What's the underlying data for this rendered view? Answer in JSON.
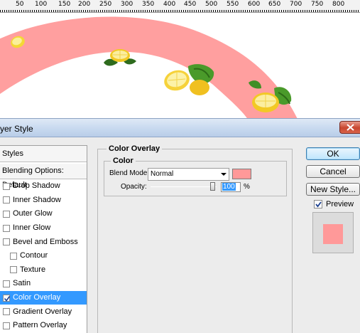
{
  "ruler": {
    "labels": [
      "50",
      "100",
      "150",
      "200",
      "250",
      "300",
      "350",
      "400",
      "450",
      "500",
      "550",
      "600",
      "650",
      "700",
      "750",
      "800"
    ]
  },
  "dialog": {
    "title": "yer Style",
    "styles_header": "Styles",
    "blending_options": "Blending Options: Default",
    "items": [
      {
        "label": "Drop Shadow",
        "checked": false
      },
      {
        "label": "Inner Shadow",
        "checked": false
      },
      {
        "label": "Outer Glow",
        "checked": false
      },
      {
        "label": "Inner Glow",
        "checked": false
      },
      {
        "label": "Bevel and Emboss",
        "checked": false
      },
      {
        "label": "Contour",
        "checked": false
      },
      {
        "label": "Texture",
        "checked": false
      },
      {
        "label": "Satin",
        "checked": false
      },
      {
        "label": "Color Overlay",
        "checked": true,
        "selected": true
      },
      {
        "label": "Gradient Overlay",
        "checked": false
      },
      {
        "label": "Pattern Overlay",
        "checked": false
      }
    ],
    "panel": {
      "group_title": "Color Overlay",
      "subgroup_title": "Color",
      "blend_mode_label": "Blend Mode:",
      "blend_mode_value": "Normal",
      "overlay_color": "#ff9999",
      "opacity_label": "Opacity:",
      "opacity_value": "100",
      "opacity_unit": "%"
    },
    "buttons": {
      "ok": "OK",
      "cancel": "Cancel",
      "new_style": "New Style...",
      "preview": "Preview"
    }
  }
}
